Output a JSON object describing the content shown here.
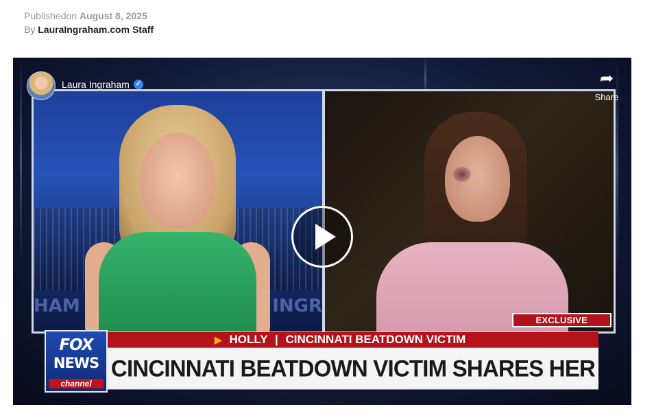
{
  "article": {
    "published_prefix": "Publishedon",
    "published_date": "August 8, 2025",
    "by_prefix": "By",
    "author": "LauraIngraham.com Staff"
  },
  "video": {
    "channel_name": "Laura Ingraham",
    "verified_icon": "verified-check-icon",
    "share_label": "Share",
    "share_icon": "share-arrow-icon",
    "play_icon": "play-icon",
    "wall_text_left": "HAM",
    "wall_text_right": "INGR",
    "exclusive_label": "EXCLUSIVE",
    "network": {
      "fox": "FOX",
      "news": "NEWS",
      "channel": "channel"
    },
    "chyron": {
      "guest_name": "HOLLY",
      "guest_tag": "CINCINNATI BEATDOWN VICTIM",
      "headline": "CINCINNATI BEATDOWN VICTIM SHARES HER STORY"
    }
  }
}
